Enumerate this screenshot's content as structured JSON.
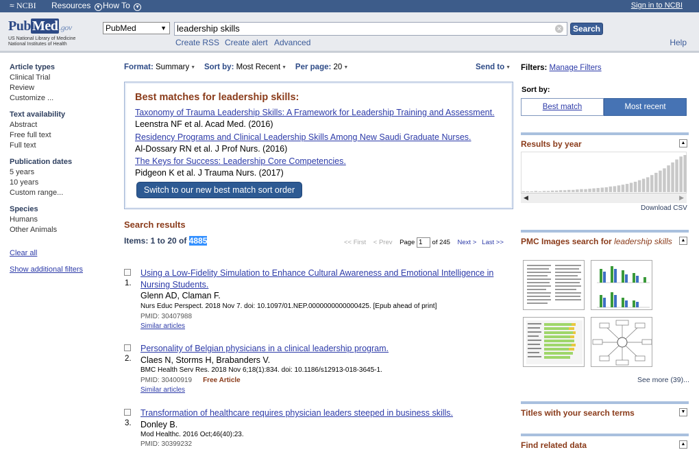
{
  "topbar": {
    "brand": "NCBI",
    "resources": "Resources",
    "howto": "How To",
    "signin": "Sign in to NCBI"
  },
  "header": {
    "logo_pub": "Pub",
    "logo_med": "Med",
    "logo_gov": ".gov",
    "logo_line1": "US National Library of Medicine",
    "logo_line2": "National Institutes of Health",
    "db": "PubMed",
    "query": "leadership skills",
    "search_btn": "Search",
    "links": [
      "Create RSS",
      "Create alert",
      "Advanced"
    ],
    "help": "Help"
  },
  "left": {
    "groups": [
      {
        "head": "Article types",
        "items": [
          "Clinical Trial",
          "Review",
          "Customize ..."
        ]
      },
      {
        "head": "Text availability",
        "items": [
          "Abstract",
          "Free full text",
          "Full text"
        ]
      },
      {
        "head": "Publication dates",
        "items": [
          "5 years",
          "10 years",
          "Custom range..."
        ]
      },
      {
        "head": "Species",
        "items": [
          "Humans",
          "Other Animals"
        ]
      }
    ],
    "clear_all": "Clear all",
    "show_filters": "Show additional filters"
  },
  "format_bar": {
    "format_label": "Format:",
    "format_value": "Summary",
    "sort_label": "Sort by:",
    "sort_value": "Most Recent",
    "perpage_label": "Per page:",
    "perpage_value": "20",
    "sendto": "Send to"
  },
  "best": {
    "heading": "Best matches for leadership skills:",
    "items": [
      {
        "title": "Taxonomy of Trauma Leadership Skills: A Framework for Leadership Training and Assessment.",
        "authors": "Leenstra NF et al. Acad Med. (2016)"
      },
      {
        "title": "Residency Programs and Clinical Leadership Skills Among New Saudi Graduate Nurses.",
        "authors": "Al-Dossary RN et al. J Prof Nurs. (2016)"
      },
      {
        "title": "The Keys for Success: Leadership Core Competencies.",
        "authors": "Pidgeon K et al. J Trauma Nurs. (2017)"
      }
    ],
    "switch_btn": "Switch to our new best match sort order"
  },
  "results": {
    "heading": "Search results",
    "items_prefix": "Items: 1 to 20 of ",
    "total": "4885",
    "pager": {
      "first": "<< First",
      "prev": "< Prev",
      "page_label": "Page",
      "page": "1",
      "of": "of 245",
      "next": "Next >",
      "last": "Last >>"
    },
    "list": [
      {
        "num": "1.",
        "title": "Using a Low-Fidelity Simulation to Enhance Cultural Awareness and Emotional Intelligence in Nursing Students.",
        "authors": "Glenn AD, Claman F.",
        "source": "Nurs Educ Perspect. 2018 Nov 7. doi: 10.1097/01.NEP.0000000000000425. [Epub ahead of print]",
        "pmid": "PMID: 30407988",
        "free": "",
        "similar": "Similar articles"
      },
      {
        "num": "2.",
        "title": "Personality of Belgian physicians in a clinical leadership program.",
        "authors": "Claes N, Storms H, Brabanders V.",
        "source": "BMC Health Serv Res. 2018 Nov 6;18(1):834. doi: 10.1186/s12913-018-3645-1.",
        "pmid": "PMID: 30400919",
        "free": "Free Article",
        "similar": "Similar articles"
      },
      {
        "num": "3.",
        "title": "Transformation of healthcare requires physician leaders steeped in business skills.",
        "authors": "Donley B.",
        "source": "Mod Healthc. 2016 Oct;46(40):23.",
        "pmid": "PMID: 30399232",
        "free": "",
        "similar": ""
      }
    ]
  },
  "right": {
    "filters_label": "Filters:",
    "manage_filters": "Manage Filters",
    "sort_by": "Sort by:",
    "sort_best": "Best match",
    "sort_recent": "Most recent",
    "results_by_year": "Results by year",
    "download_csv": "Download CSV",
    "pmc_prefix": "PMC Images search for ",
    "pmc_term": "leadership skills",
    "see_more": "See more (39)...",
    "titles_terms": "Titles with your search terms",
    "find_related": "Find related data"
  },
  "year_bars": [
    2,
    2,
    2,
    3,
    2,
    3,
    3,
    4,
    4,
    5,
    5,
    6,
    6,
    7,
    8,
    8,
    9,
    10,
    11,
    12,
    13,
    15,
    16,
    18,
    20,
    22,
    25,
    28,
    32,
    36,
    40,
    46,
    52,
    58,
    64,
    72,
    80,
    88,
    96,
    100
  ]
}
